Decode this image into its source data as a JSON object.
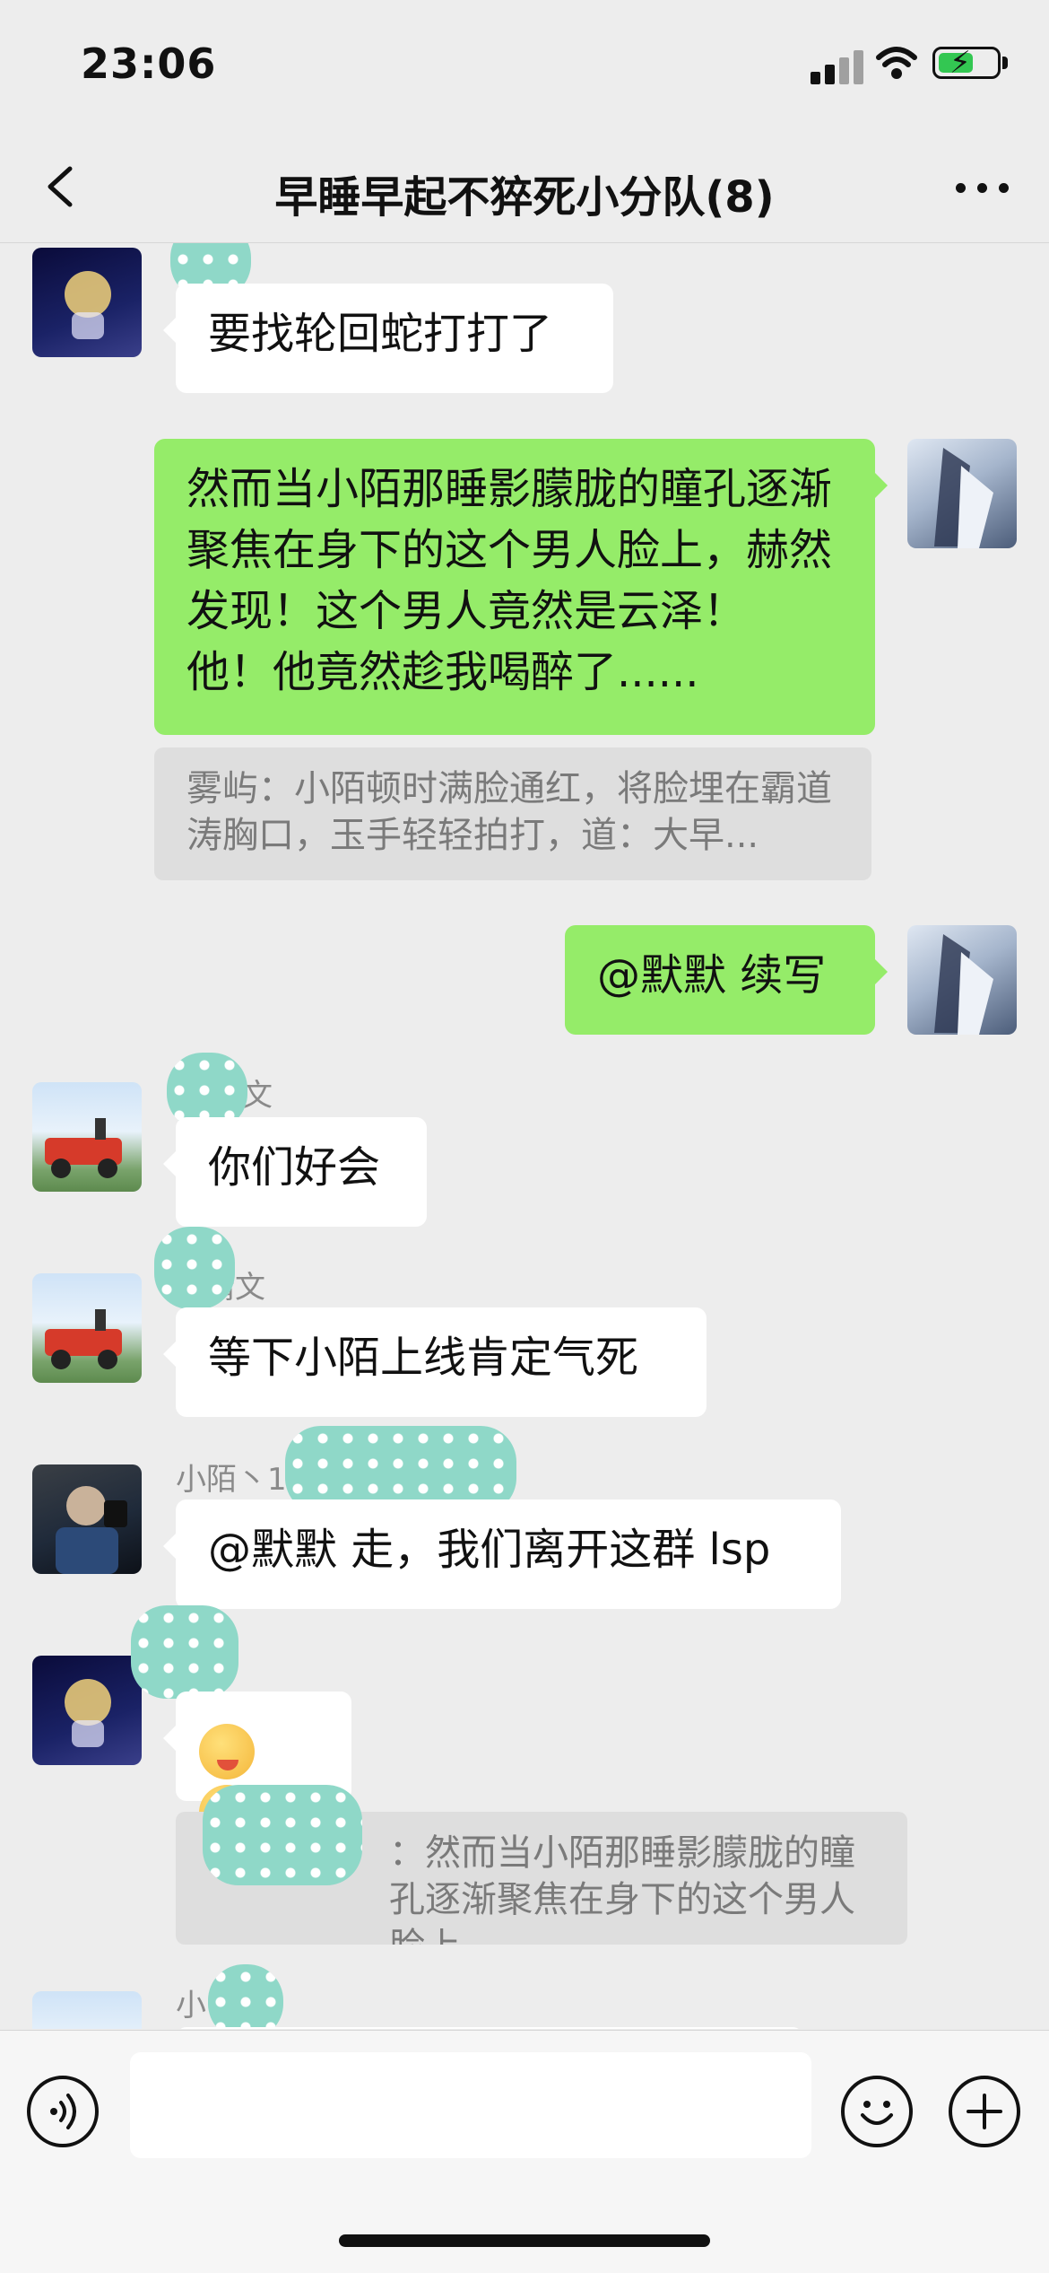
{
  "status_bar": {
    "time": "23:06"
  },
  "header": {
    "title": "早睡早起不猝死小分队(8)"
  },
  "messages": [
    {
      "side": "left",
      "text": "要找轮回蛇打打了"
    },
    {
      "side": "right",
      "text": "然而当小陌那睡影朦胧的瞳孔逐渐聚焦在身下的这个男人脸上，赫然发现！这个男人竟然是云泽！ 他！他竟然趁我喝醉了......",
      "quote": "雾屿：小陌顿时满脸通红，将脸埋在霸道涛胸口，玉手轻轻拍打，道：大早..."
    },
    {
      "side": "right",
      "text": "@默默 续写"
    },
    {
      "side": "left",
      "sender": "文",
      "text": "你们好会"
    },
    {
      "side": "left",
      "sender": "晴文",
      "text": "等下小陌上线肯定气死"
    },
    {
      "side": "left",
      "sender": "小陌丶1",
      "text": "@默默 走，我们离开这群 lsp"
    },
    {
      "side": "left",
      "emoji": [
        "face-emoji",
        "face-emoji"
      ],
      "quote": "：然而当小陌那睡影朦胧的瞳孔逐渐聚焦在身下的这个男人脸上，..."
    },
    {
      "side": "left",
      "sender": "小"
    }
  ],
  "input": {
    "value": ""
  }
}
